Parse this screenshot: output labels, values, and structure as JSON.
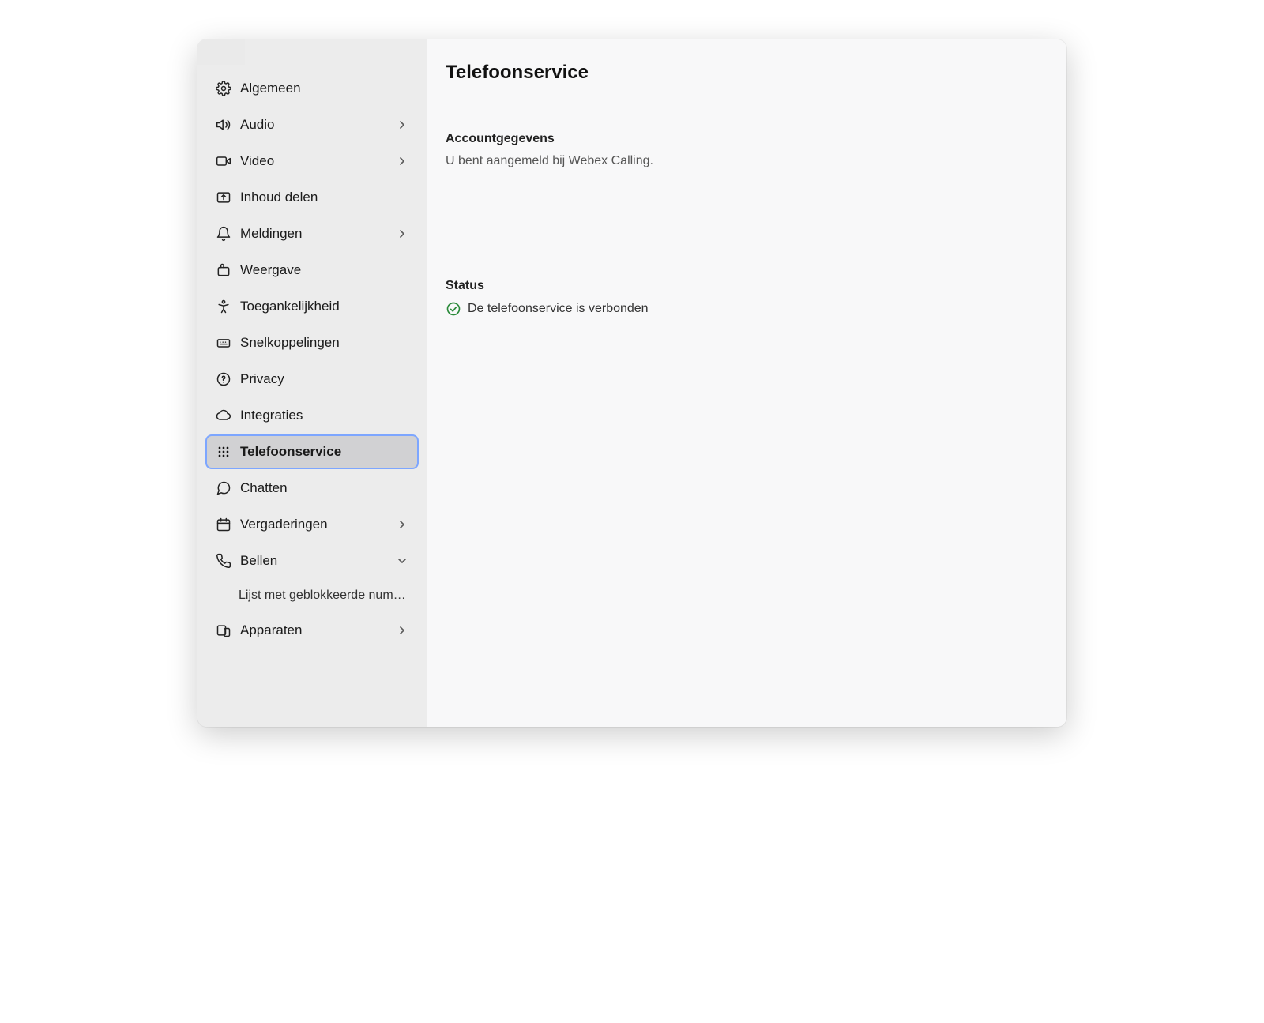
{
  "sidebar": {
    "items": [
      {
        "label": "Algemeen"
      },
      {
        "label": "Audio"
      },
      {
        "label": "Video"
      },
      {
        "label": "Inhoud delen"
      },
      {
        "label": "Meldingen"
      },
      {
        "label": "Weergave"
      },
      {
        "label": "Toegankelijkheid"
      },
      {
        "label": "Snelkoppelingen"
      },
      {
        "label": "Privacy"
      },
      {
        "label": "Integraties"
      },
      {
        "label": "Telefoonservice"
      },
      {
        "label": "Chatten"
      },
      {
        "label": "Vergaderingen"
      },
      {
        "label": "Bellen"
      },
      {
        "label": "Apparaten"
      }
    ],
    "sub_bellen": {
      "label": "Lijst met geblokkeerde num…"
    }
  },
  "main": {
    "title": "Telefoonservice",
    "account": {
      "heading": "Accountgegevens",
      "text": "U bent aangemeld bij Webex Calling."
    },
    "status": {
      "heading": "Status",
      "text": "De telefoonservice is verbonden"
    }
  },
  "colors": {
    "success": "#2a8a3a"
  }
}
